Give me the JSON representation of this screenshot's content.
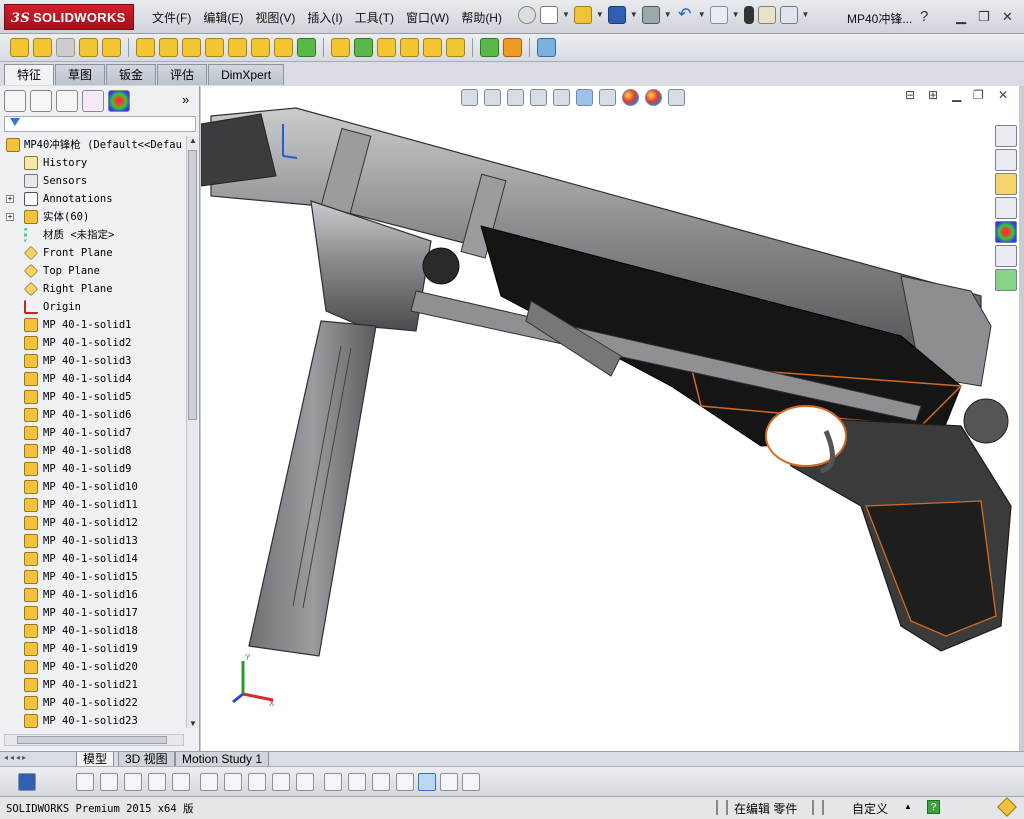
{
  "app": {
    "logo_brand": "SOLIDWORKS",
    "logo_ds": "3S",
    "document_title": "MP40冲锋...",
    "menus": [
      "文件(F)",
      "编辑(E)",
      "视图(V)",
      "插入(I)",
      "工具(T)",
      "窗口(W)",
      "帮助(H)"
    ]
  },
  "command_tabs": [
    "特征",
    "草图",
    "钣金",
    "评估",
    "DimXpert"
  ],
  "feature_tree": {
    "root": "MP40冲锋枪  (Default<<Defau",
    "items": [
      {
        "label": "History",
        "icon": "history-icon"
      },
      {
        "label": "Sensors",
        "icon": "sensors-icon"
      },
      {
        "label": "Annotations",
        "icon": "annotations-icon",
        "expandable": true
      },
      {
        "label": "实体(60)",
        "icon": "solid-bodies-icon",
        "expandable": true
      },
      {
        "label": "材质 <未指定>",
        "icon": "material-icon"
      },
      {
        "label": "Front Plane",
        "icon": "plane-icon"
      },
      {
        "label": "Top Plane",
        "icon": "plane-icon"
      },
      {
        "label": "Right Plane",
        "icon": "plane-icon"
      },
      {
        "label": "Origin",
        "icon": "origin-icon"
      }
    ],
    "bodies": [
      "MP 40-1-solid1",
      "MP 40-1-solid2",
      "MP 40-1-solid3",
      "MP 40-1-solid4",
      "MP 40-1-solid5",
      "MP 40-1-solid6",
      "MP 40-1-solid7",
      "MP 40-1-solid8",
      "MP 40-1-solid9",
      "MP 40-1-solid10",
      "MP 40-1-solid11",
      "MP 40-1-solid12",
      "MP 40-1-solid13",
      "MP 40-1-solid14",
      "MP 40-1-solid15",
      "MP 40-1-solid16",
      "MP 40-1-solid17",
      "MP 40-1-solid18",
      "MP 40-1-solid19",
      "MP 40-1-solid20",
      "MP 40-1-solid21",
      "MP 40-1-solid22",
      "MP 40-1-solid23"
    ]
  },
  "bottom_tabs": [
    "模型",
    "3D 视图",
    "Motion Study 1"
  ],
  "status": {
    "version": "SOLIDWORKS Premium 2015 x64 版",
    "mode": "在编辑 零件",
    "units": "自定义"
  },
  "triad": {
    "x": "X",
    "y": "Y"
  },
  "colors": {
    "accent_red": "#c8161f",
    "model_gray": "#8c8e91",
    "edge_orange": "#d46a1e"
  }
}
